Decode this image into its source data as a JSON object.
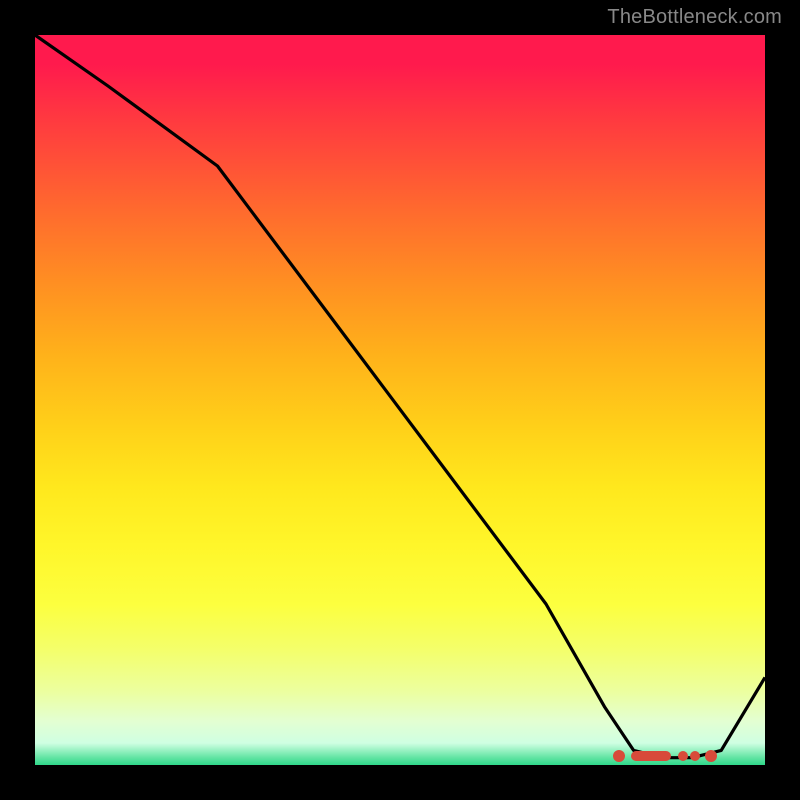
{
  "watermark": "TheBottleneck.com",
  "chart_data": {
    "type": "line",
    "title": "",
    "xlabel": "",
    "ylabel": "",
    "xlim": [
      0,
      100
    ],
    "ylim": [
      0,
      100
    ],
    "background_gradient": {
      "top": "#ff1a4d",
      "mid": "#ffd119",
      "bottom": "#2fd88a",
      "meaning": "red=high bottleneck, green=low bottleneck"
    },
    "series": [
      {
        "name": "bottleneck-curve",
        "x": [
          0,
          10,
          25,
          40,
          55,
          70,
          78,
          82,
          86,
          90,
          94,
          100
        ],
        "values": [
          100,
          93,
          82,
          62,
          42,
          22,
          8,
          2,
          1,
          1,
          2,
          12
        ]
      }
    ],
    "markers": {
      "name": "optimal-range",
      "shape": "rounded-segment",
      "color": "#d84a3a",
      "x_start": 80,
      "x_end": 92,
      "y": 1.2
    }
  }
}
